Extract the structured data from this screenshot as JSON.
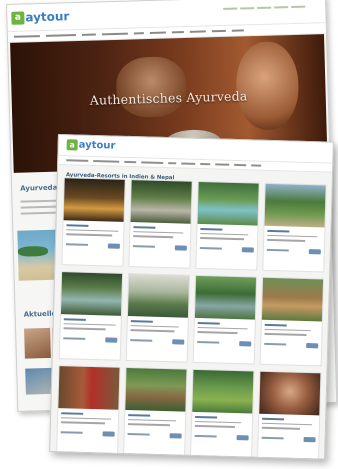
{
  "brand": {
    "logo_letter": "a",
    "logo_text": "aytour",
    "accent_green": "#6db33f",
    "accent_blue": "#3a7fc1"
  },
  "homepage": {
    "hero_title": "Authentisches Ayurveda",
    "section_1_title": "Ayurveda-Reis",
    "section_2_title": "Aktuelles aus"
  },
  "listing": {
    "title": "Ayurveda-Resorts in Indien & Nepal",
    "cards": [
      {
        "image": "resort-night-pool"
      },
      {
        "image": "garden-villa"
      },
      {
        "image": "pool-lawn"
      },
      {
        "image": "palm-garden"
      },
      {
        "image": "lake-view"
      },
      {
        "image": "white-building-pool"
      },
      {
        "image": "tree-pond"
      },
      {
        "image": "traditional-house"
      },
      {
        "image": "woman-red-sari"
      },
      {
        "image": "tropical-cottage"
      },
      {
        "image": "palm-lawn"
      },
      {
        "image": "woman-portrait"
      }
    ]
  }
}
